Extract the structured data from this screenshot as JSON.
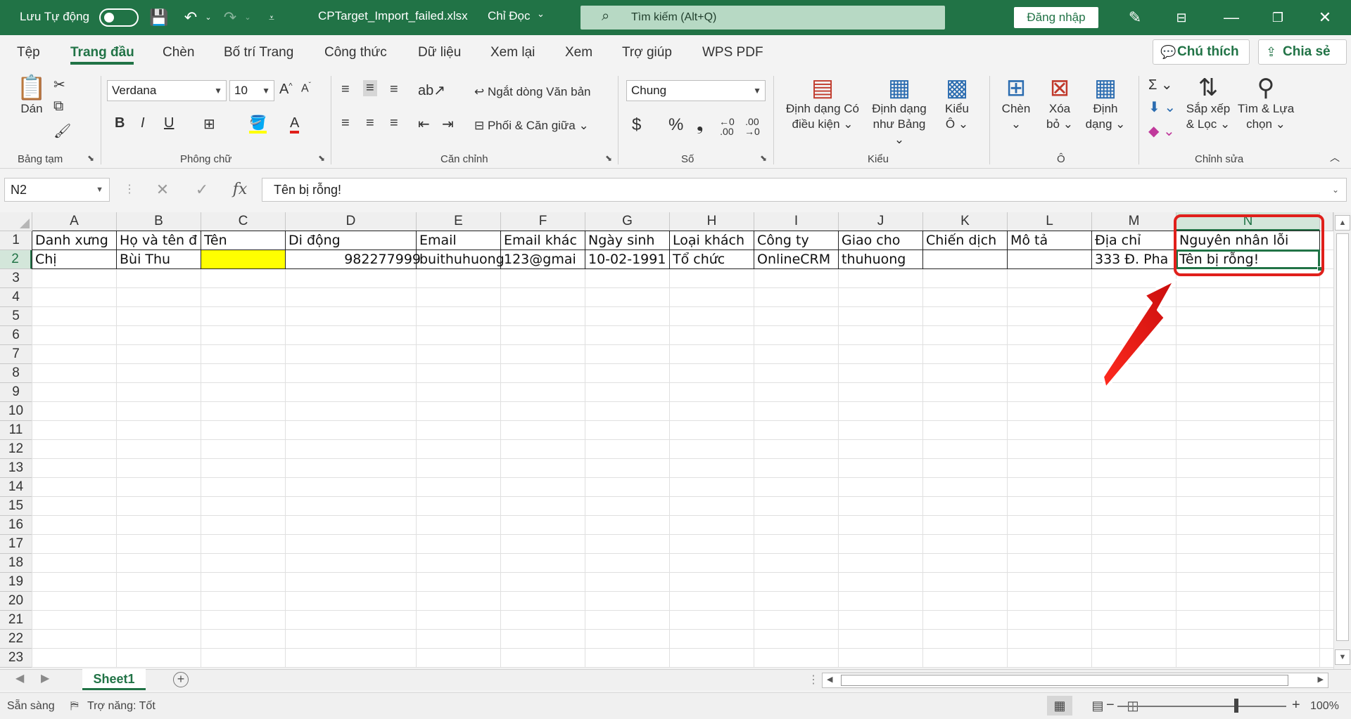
{
  "titlebar": {
    "autosave_label": "Lưu Tự động",
    "filename": "CPTarget_Import_failed.xlsx",
    "mode": "Chỉ Đọc",
    "search_placeholder": "Tìm kiếm (Alt+Q)",
    "signin_label": "Đăng nhập",
    "accent_color": "#217346"
  },
  "tabs": [
    "Tệp",
    "Trang đầu",
    "Chèn",
    "Bố trí Trang",
    "Công thức",
    "Dữ liệu",
    "Xem lại",
    "Xem",
    "Trợ giúp",
    "WPS PDF"
  ],
  "active_tab": "Trang đầu",
  "side_buttons": {
    "comments": "Chú thích",
    "share": "Chia sẻ"
  },
  "ribbon": {
    "clipboard": {
      "paste": "Dán",
      "group": "Bảng tạm"
    },
    "font": {
      "name": "Verdana",
      "size": "10",
      "bold": "B",
      "italic": "I",
      "underline": "U",
      "group": "Phông chữ"
    },
    "alignment": {
      "wrap": "Ngắt dòng Văn bản",
      "merge": "Phối & Căn giữa",
      "group": "Căn chỉnh"
    },
    "number": {
      "format": "Chung",
      "currency": "$",
      "percent": "%",
      "comma": "❟",
      "group": "Số"
    },
    "styles": {
      "conditional_1": "Định dạng Có",
      "conditional_2": "điều kiện",
      "table_1": "Định dạng",
      "table_2": "như Bảng",
      "cell_1": "Kiểu",
      "cell_2": "Ô",
      "group": "Kiểu"
    },
    "cells": {
      "insert": "Chèn",
      "delete_1": "Xóa",
      "delete_2": "bỏ",
      "format_1": "Định",
      "format_2": "dạng",
      "group": "Ô"
    },
    "editing": {
      "sort_1": "Sắp xếp",
      "sort_2": "& Lọc",
      "find_1": "Tìm & Lựa",
      "find_2": "chọn",
      "group": "Chỉnh sửa"
    }
  },
  "formula_bar": {
    "name_box": "N2",
    "fx": "fx",
    "value": "Tên bị rỗng!"
  },
  "columns": [
    "A",
    "B",
    "C",
    "D",
    "E",
    "F",
    "G",
    "H",
    "I",
    "J",
    "K",
    "L",
    "M",
    "N"
  ],
  "rows": [
    "1",
    "2",
    "3",
    "4",
    "5",
    "6",
    "7",
    "8",
    "9",
    "10",
    "11",
    "12",
    "13",
    "14",
    "15",
    "16",
    "17",
    "18",
    "19",
    "20",
    "21",
    "22",
    "23"
  ],
  "cells": {
    "row1": [
      "Danh xưng",
      "Họ và tên đ",
      "Tên",
      "Di động",
      "Email",
      "Email khác",
      "Ngày sinh",
      "Loại khách",
      "Công ty",
      "Giao cho",
      "Chiến dịch",
      "Mô tả",
      "Địa chỉ",
      "Nguyên nhân lỗi"
    ],
    "row2": [
      "Chị",
      "Bùi Thu",
      "",
      "982277999",
      "buithuhuong",
      "123@gmai",
      "10-02-1991",
      "Tổ chức",
      "OnlineCRM",
      "thuhuong",
      "",
      "",
      "333 Đ. Pha",
      "Tên bị rỗng!"
    ]
  },
  "highlight_fill": "#ffff00",
  "annotation_color": "#e0201b",
  "sheet_tab": "Sheet1",
  "status": {
    "ready": "Sẵn sàng",
    "accessibility": "Trợ năng: Tốt",
    "zoom": "100%"
  }
}
